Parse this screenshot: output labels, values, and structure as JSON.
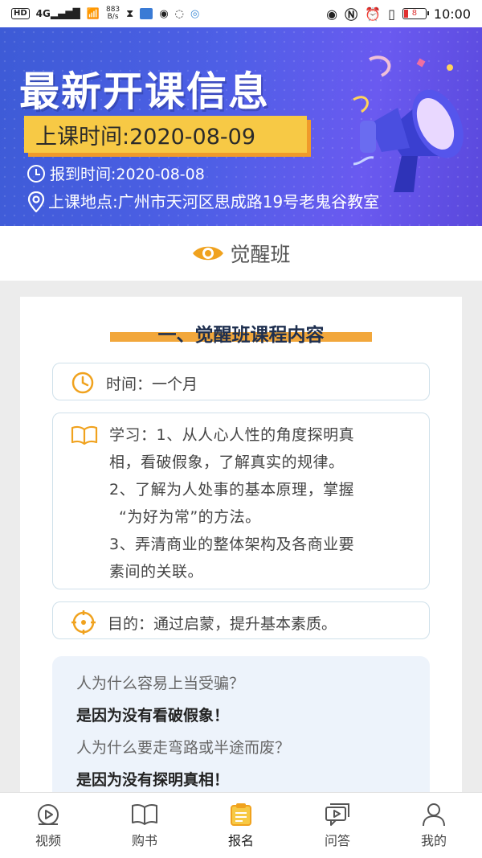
{
  "status_bar": {
    "hd": "HD",
    "signal": "4G",
    "net_speed": "883\nB/s",
    "net_speed_value": "883",
    "net_speed_unit": "B/s",
    "battery": "8",
    "time": "10:00"
  },
  "banner": {
    "title": "最新开课信息",
    "class_time": "上课时间:2020-08-09",
    "report_time": "报到时间:2020-08-08",
    "location": "上课地点:广州市天河区思成路19号老鬼谷教室"
  },
  "section": {
    "label": "觉醒班"
  },
  "course": {
    "title": "一、觉醒班课程内容",
    "time_text": "时间：一个月",
    "study_lines": [
      "学习：1、从人心人性的角度探明真",
      "相，看破假象，了解真实的规律。",
      "2、了解为人处事的基本原理，掌握",
      "“为好为常”的方法。",
      "3、弄清商业的整体架构及各商业要",
      "素间的关联。"
    ],
    "goal_text": "目的：通过启蒙，提升基本素质。",
    "qa": [
      {
        "q": "人为什么容易上当受骗？",
        "a": "是因为没有看破假象！"
      },
      {
        "q": "人为什么要走弯路或半途而废？",
        "a": "是因为没有探明真相！"
      }
    ]
  },
  "nav": {
    "items": [
      {
        "label": "视频",
        "icon": "play-circle-icon"
      },
      {
        "label": "购书",
        "icon": "book-icon"
      },
      {
        "label": "报名",
        "icon": "clipboard-icon",
        "active": true
      },
      {
        "label": "问答",
        "icon": "chat-icon"
      },
      {
        "label": "我的",
        "icon": "user-icon"
      }
    ]
  },
  "colors": {
    "banner_blue": "#4e5fe6",
    "accent_orange": "#f2a73b",
    "date_yellow": "#f7c945",
    "eye_orange": "#f0a21e"
  }
}
